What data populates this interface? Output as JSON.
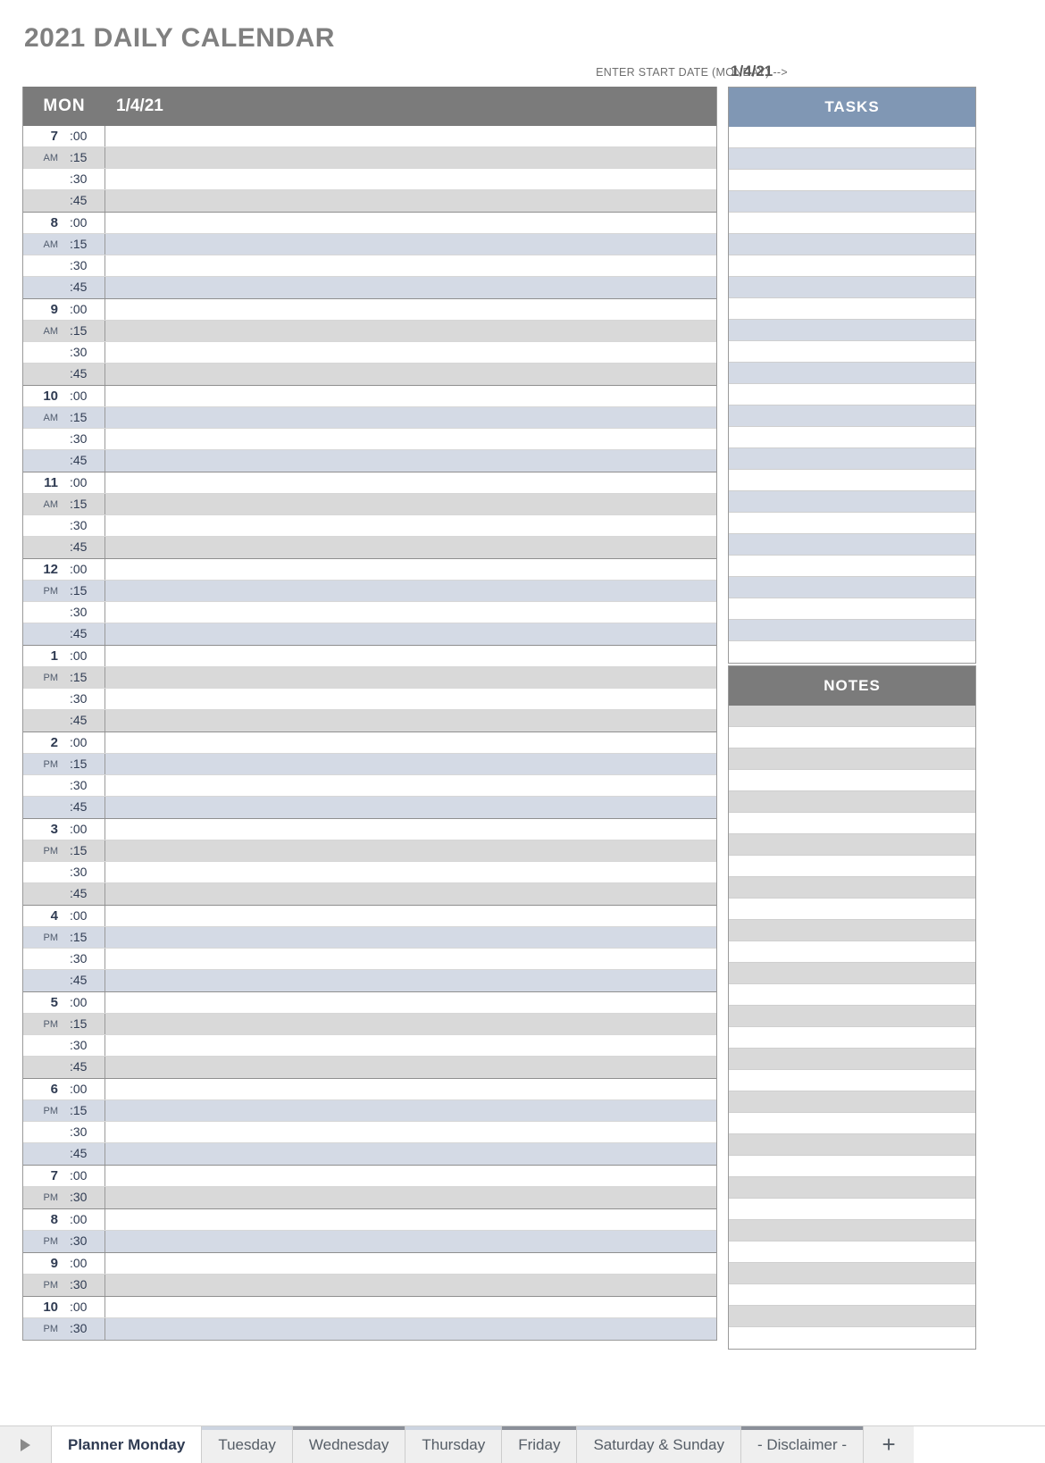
{
  "page": {
    "title": "2021 DAILY CALENDAR",
    "start_date_label": "ENTER START DATE (MONDAY) -->",
    "start_date_value": "1/4/21"
  },
  "calendar": {
    "day_of_week": "MON",
    "date": "1/4/21",
    "quarter_minutes": [
      ":00",
      ":15",
      ":30",
      ":45"
    ],
    "half_minutes": [
      ":00",
      ":30"
    ],
    "hours": [
      {
        "hour": "7",
        "ampm": "AM",
        "shade": "gray",
        "granularity": "quarter"
      },
      {
        "hour": "8",
        "ampm": "AM",
        "shade": "blue",
        "granularity": "quarter"
      },
      {
        "hour": "9",
        "ampm": "AM",
        "shade": "gray",
        "granularity": "quarter"
      },
      {
        "hour": "10",
        "ampm": "AM",
        "shade": "blue",
        "granularity": "quarter"
      },
      {
        "hour": "11",
        "ampm": "AM",
        "shade": "gray",
        "granularity": "quarter"
      },
      {
        "hour": "12",
        "ampm": "PM",
        "shade": "blue",
        "granularity": "quarter"
      },
      {
        "hour": "1",
        "ampm": "PM",
        "shade": "gray",
        "granularity": "quarter"
      },
      {
        "hour": "2",
        "ampm": "PM",
        "shade": "blue",
        "granularity": "quarter"
      },
      {
        "hour": "3",
        "ampm": "PM",
        "shade": "gray",
        "granularity": "quarter"
      },
      {
        "hour": "4",
        "ampm": "PM",
        "shade": "blue",
        "granularity": "quarter"
      },
      {
        "hour": "5",
        "ampm": "PM",
        "shade": "gray",
        "granularity": "quarter"
      },
      {
        "hour": "6",
        "ampm": "PM",
        "shade": "blue",
        "granularity": "quarter"
      },
      {
        "hour": "7",
        "ampm": "PM",
        "shade": "gray",
        "granularity": "half"
      },
      {
        "hour": "8",
        "ampm": "PM",
        "shade": "blue",
        "granularity": "half"
      },
      {
        "hour": "9",
        "ampm": "PM",
        "shade": "gray",
        "granularity": "half"
      },
      {
        "hour": "10",
        "ampm": "PM",
        "shade": "blue",
        "granularity": "half"
      }
    ]
  },
  "tasks": {
    "header": "TASKS",
    "row_count": 25,
    "rows": []
  },
  "notes": {
    "header": "NOTES",
    "row_count": 30,
    "rows": []
  },
  "tabs": {
    "nav_icon": "play-arrow-right-icon",
    "add_label": "+",
    "items": [
      {
        "label": "Planner Monday",
        "active": true,
        "accent": "#ffffff"
      },
      {
        "label": "Tuesday",
        "active": false,
        "accent": "#ccd4e0"
      },
      {
        "label": "Wednesday",
        "active": false,
        "accent": "#8a8f99"
      },
      {
        "label": "Thursday",
        "active": false,
        "accent": "#ccd4e0"
      },
      {
        "label": "Friday",
        "active": false,
        "accent": "#8a8f99"
      },
      {
        "label": "Saturday & Sunday",
        "active": false,
        "accent": "#ccd4e0"
      },
      {
        "label": "- Disclaimer -",
        "active": false,
        "accent": "#8a8f99"
      }
    ]
  },
  "colors": {
    "header_gray": "#7b7b7b",
    "tasks_blue": "#8097b4",
    "shade_gray": "#d9d9d9",
    "shade_blue": "#d4dae5",
    "title_gray": "#808080",
    "text_navy": "#2f3b52"
  }
}
